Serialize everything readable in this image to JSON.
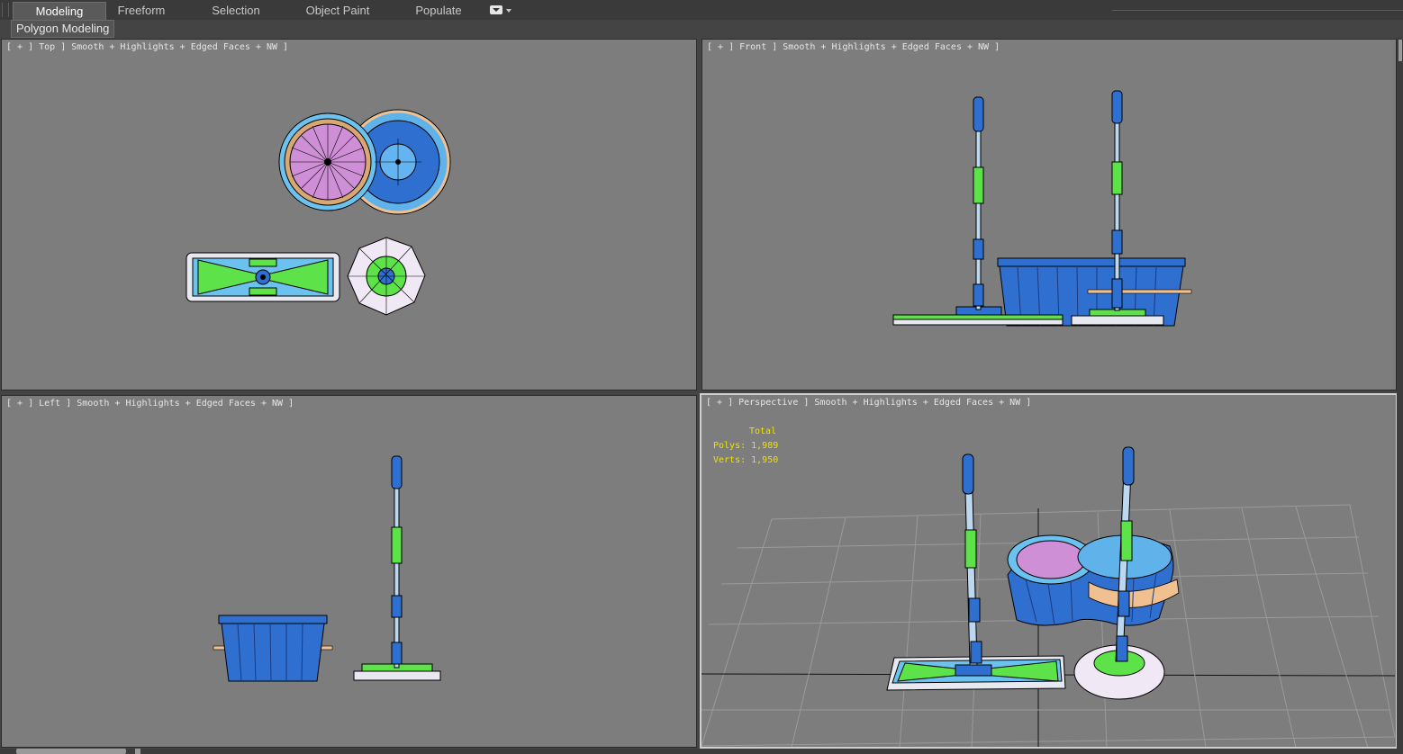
{
  "ribbon": {
    "tabs": [
      {
        "label": "Modeling",
        "active": true
      },
      {
        "label": "Freeform",
        "active": false
      },
      {
        "label": "Selection",
        "active": false
      },
      {
        "label": "Object Paint",
        "active": false
      },
      {
        "label": "Populate",
        "active": false
      }
    ],
    "dropdown_icon": "ribbon-options-icon",
    "subtab": "Polygon Modeling"
  },
  "viewports": {
    "top": {
      "label": "[ + ] Top ] Smooth + Highlights + Edged Faces + NW ]"
    },
    "front": {
      "label": "[ + ] Front ] Smooth + Highlights + Edged Faces + NW ]"
    },
    "left": {
      "label": "[ + ] Left ] Smooth + Highlights + Edged Faces + NW ]"
    },
    "perspective": {
      "label": "[ + ] Perspective ] Smooth + Highlights + Edged Faces + NW ]",
      "stats": {
        "total": "Total",
        "polys": "Polys: 1,989",
        "verts": "Verts: 1,950"
      }
    }
  },
  "colors": {
    "viewport_bg": "#7d7d7d",
    "bucket_blue": "#2f6fd0",
    "mop_green": "#5ee24a",
    "stats_yellow": "#f0e000"
  }
}
